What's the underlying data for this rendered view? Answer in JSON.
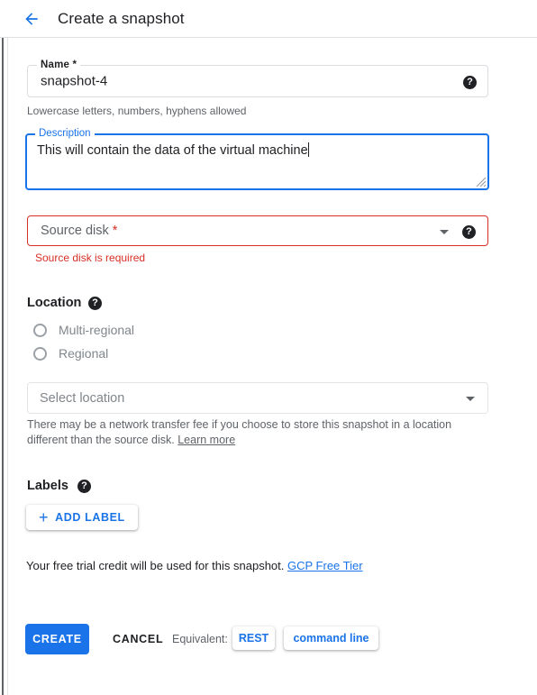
{
  "header": {
    "back_icon": "arrow-left-icon",
    "title": "Create a snapshot"
  },
  "colors": {
    "accent": "#1a73e8",
    "error": "#d93025",
    "text": "#202124",
    "muted": "#5f6368",
    "border": "#dadce0"
  },
  "form": {
    "name_field": {
      "label": "Name *",
      "value": "snapshot-4",
      "hint": "Lowercase letters, numbers, hyphens allowed",
      "help_icon": "help-circle-icon",
      "help_glyph": "?"
    },
    "description_field": {
      "label": "Description",
      "value": "This will contain the data of the virtual machine",
      "resize_icon": "resize-grip-icon"
    },
    "source_disk_field": {
      "placeholder": "Source disk ",
      "required_mark": "*",
      "error": "Source disk is required",
      "dropdown_icon": "chevron-down-icon",
      "help_icon": "help-circle-icon",
      "help_glyph": "?"
    },
    "location_section": {
      "title": "Location",
      "help_icon": "help-circle-icon",
      "help_glyph": "?",
      "options": [
        {
          "label": "Multi-regional",
          "selected": false
        },
        {
          "label": "Regional",
          "selected": false
        }
      ],
      "select_placeholder": "Select location",
      "dropdown_icon": "chevron-down-icon",
      "note_text": "There may be a network transfer fee if you choose to store this snapshot in a location different than the source disk. ",
      "note_link": "Learn more"
    },
    "labels_section": {
      "title": "Labels",
      "help_icon": "help-circle-icon",
      "help_glyph": "?",
      "add_label_button": "ADD LABEL",
      "plus_glyph": "+"
    },
    "trial_note": {
      "text": "Your free trial credit will be used for this snapshot. ",
      "link": "GCP Free Tier"
    }
  },
  "footer": {
    "create_label": "CREATE",
    "cancel_label": "CANCEL",
    "equivalent_label": "Equivalent:",
    "rest_label": "REST",
    "command_line_label": "command line"
  }
}
